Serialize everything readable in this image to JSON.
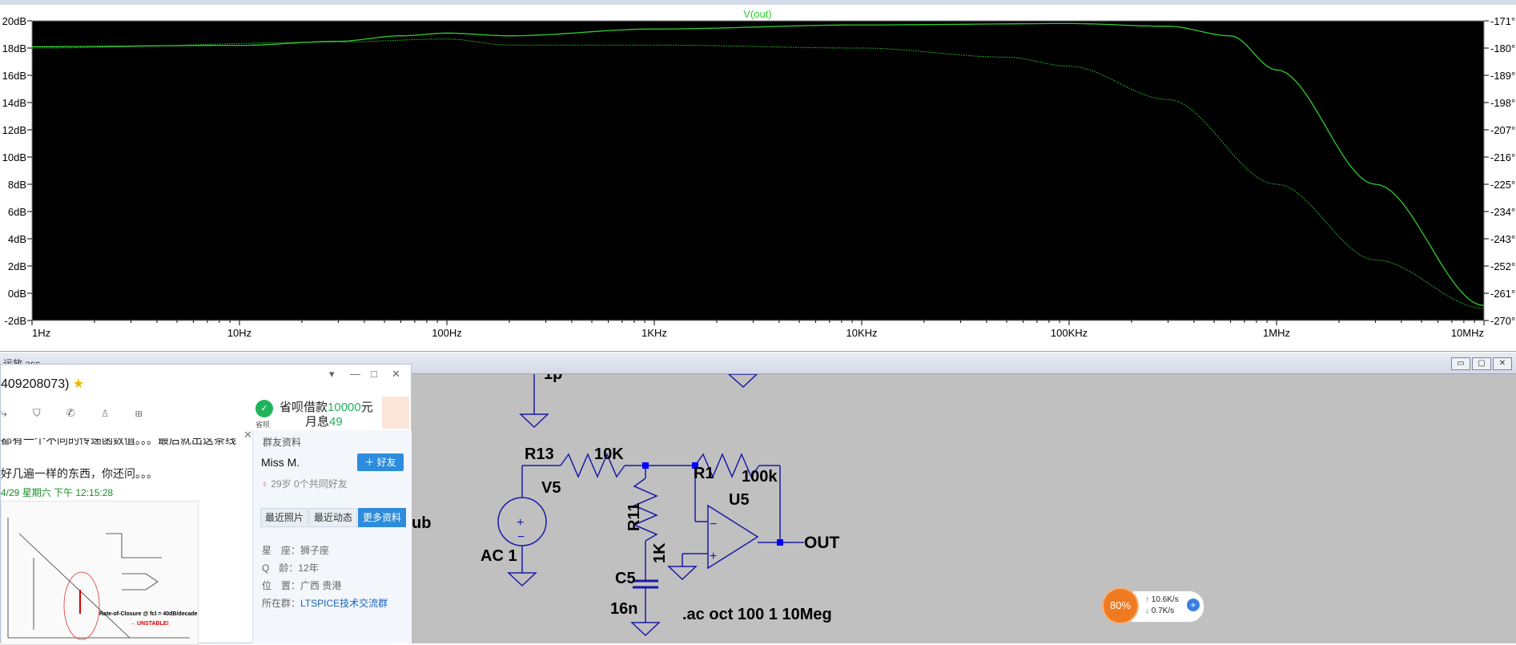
{
  "plot": {
    "trace_label": "V(out)",
    "left_ticks": [
      "20dB",
      "18dB",
      "16dB",
      "14dB",
      "12dB",
      "10dB",
      "8dB",
      "6dB",
      "4dB",
      "2dB",
      "0dB",
      "-2dB"
    ],
    "right_ticks": [
      "-171°",
      "-180°",
      "-189°",
      "-198°",
      "-207°",
      "-216°",
      "-225°",
      "-234°",
      "-243°",
      "-252°",
      "-261°",
      "-270°"
    ],
    "x_ticks": [
      "1Hz",
      "10Hz",
      "100Hz",
      "1KHz",
      "10KHz",
      "100KHz",
      "1MHz",
      "10MHz"
    ],
    "colors": {
      "background": "#000000",
      "trace": "#2ecc2e",
      "grid": "#3a3a3a"
    }
  },
  "chart_data": {
    "type": "line",
    "x_scale": "log",
    "x_range": [
      "1Hz",
      "10MHz"
    ],
    "y_left_range_db": [
      -2,
      20
    ],
    "y_right_range_deg": [
      -270,
      -171
    ],
    "series": [
      {
        "name": "V(out)",
        "points": [
          [
            1,
            18.1
          ],
          [
            10,
            18.2
          ],
          [
            30,
            18.5
          ],
          [
            60,
            18.9
          ],
          [
            100,
            19.1
          ],
          [
            200,
            18.9
          ],
          [
            1000,
            19.4
          ],
          [
            10000,
            19.7
          ],
          [
            100000,
            19.8
          ],
          [
            300000,
            19.6
          ],
          [
            600000,
            18.9
          ],
          [
            1000000,
            16.4
          ],
          [
            3000000,
            8.0
          ],
          [
            10000000,
            -0.9
          ]
        ]
      },
      {
        "points": [
          [
            1,
            -180
          ],
          [
            30,
            -178
          ],
          [
            100,
            -177
          ],
          [
            200,
            -179
          ],
          [
            1000,
            -179
          ],
          [
            10000,
            -180
          ],
          [
            50000,
            -183
          ],
          [
            100000,
            -186
          ],
          [
            300000,
            -197
          ],
          [
            1000000,
            -225
          ],
          [
            3000000,
            -250
          ],
          [
            10000000,
            -266
          ]
        ]
      }
    ]
  },
  "schematic": {
    "window_title": "运放 asc",
    "labels": {
      "cap_top": "1p",
      "r13": "R13",
      "r13_val": "10K",
      "v5": "V5",
      "ac1": "AC 1",
      "r11": "R11",
      "r11_val": "1K",
      "c5": "C5",
      "c5_val": "16n",
      "r1": "R1",
      "r1_val": "100k",
      "u5": "U5",
      "out": "OUT",
      "directive": ".ac oct 100 1 10Meg",
      "partial_ub": "ub"
    },
    "colors": {
      "wire": "#1a1aa6",
      "text": "#000000",
      "node": "#0000ff"
    }
  },
  "qq": {
    "title": "409208073)",
    "ad_line1": "省呗借款",
    "ad_amount": "10000",
    "ad_unit": "元",
    "ad_line2": "月息",
    "ad_rate": "49",
    "ad_app": "省呗",
    "section_label": "群友资料",
    "user_name": "Miss M.",
    "add_friend": "好友",
    "user_meta": "29岁 0个共同好友",
    "tabs": [
      "最近照片",
      "最近动态",
      "更多资料"
    ],
    "info": [
      {
        "label": "星　座：",
        "value": "狮子座"
      },
      {
        "label": "Q　龄：",
        "value": "12年"
      },
      {
        "label": "位　置：",
        "value": "广西 贵港"
      },
      {
        "label": "所在群：",
        "value": "LTSPICE技术交流群"
      }
    ],
    "chat_line1": "都有一个不同的传递函数值。。。最后就出这条线",
    "chat_line2": "好几遍一样的东西，你还问。。。",
    "timestamp": "4/29 星期六 下午 12:15:28",
    "thumb_text": "Rate-of-Closure @ fcl = 40dB/decade",
    "thumb_text2": "→ UNSTABLE!"
  },
  "speed": {
    "percent": "80%",
    "up": "10.6K/s",
    "down": "0.7K/s"
  }
}
